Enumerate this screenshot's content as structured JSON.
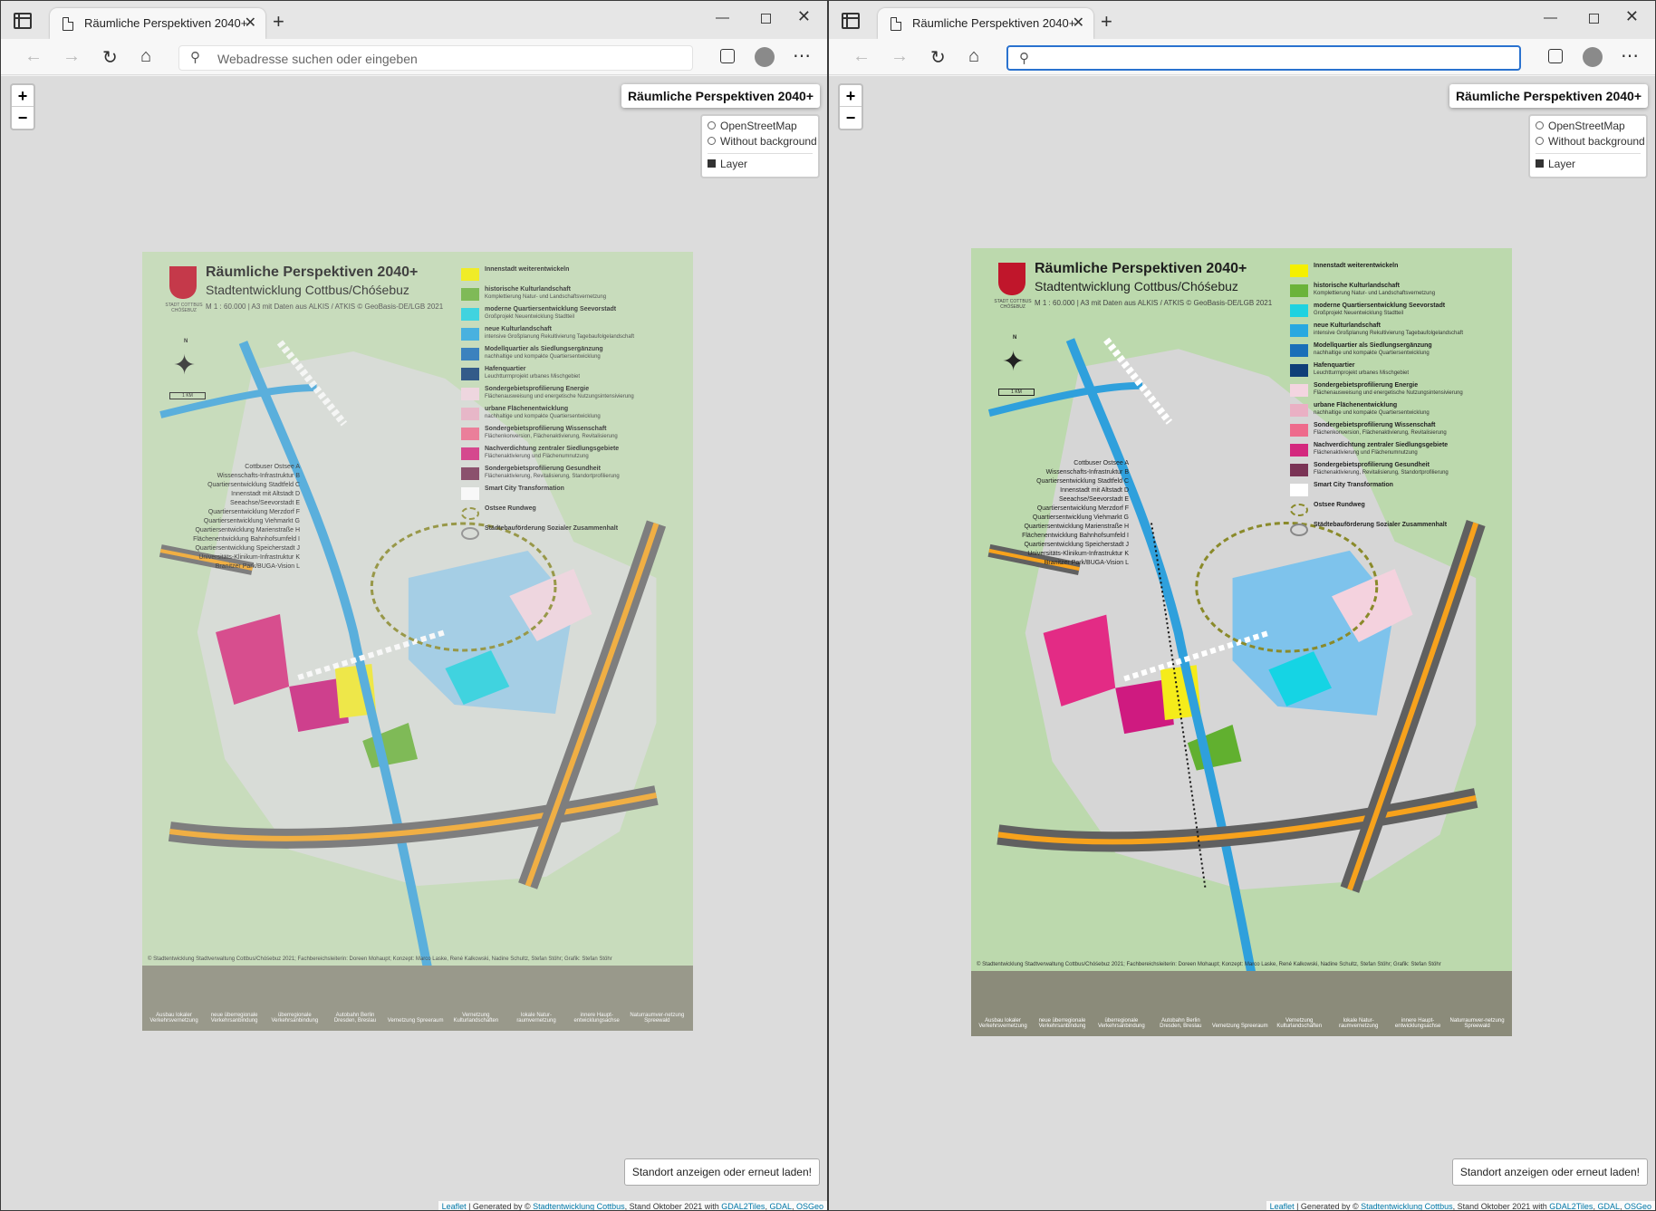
{
  "browser": {
    "tab_title": "Räumliche Perspektiven 2040+",
    "close_glyph": "✕",
    "new_tab_glyph": "+",
    "address_placeholder_left": "Webadresse suchen oder eingeben",
    "address_value_right": ""
  },
  "map": {
    "zoom_in": "+",
    "zoom_out": "−",
    "title": "Räumliche Perspektiven 2040+",
    "layers": {
      "osm": "OpenStreetMap",
      "without_bg": "Without background",
      "layer": "Layer"
    },
    "locate_button": "Standort anzeigen oder erneut laden!",
    "attribution": {
      "leaflet": "Leaflet",
      "generated_by": " | Generated by © ",
      "stadtentwicklung": "Stadtentwicklung Cottbus",
      "stand": ", Stand Oktober 2021 with ",
      "gdal2tiles": "GDAL2Tiles",
      "sep": ", ",
      "gdal": "GDAL",
      "osgeo": "OSGeo"
    }
  },
  "poster": {
    "title": "Räumliche Perspektiven 2040+",
    "subtitle": "Stadtentwicklung Cottbus/Chóśebuz",
    "scale": "M 1 : 60.000 | A3 mit Daten aus ALKIS / ATKIS © GeoBasis-DE/LGB 2021",
    "crest_caption": "STADT COTTBUS CHÓŚEBUZ",
    "compass_n": "N",
    "scalebar": "1 KM",
    "legend": [
      {
        "title": "Innenstadt weiterentwickeln",
        "sub": "",
        "color": "#f5f000"
      },
      {
        "title": "historische Kulturlandschaft",
        "sub": "Komplettierung Natur- und Landschaftsvernetzung",
        "color": "#6bb33a"
      },
      {
        "title": "moderne Quartiersentwicklung Seevorstadt",
        "sub": "Großprojekt Neuentwicklung Stadtteil",
        "color": "#1fd2e0"
      },
      {
        "title": "neue Kulturlandschaft",
        "sub": "intensive Großplanung Rekultivierung Tagebaufolgelandschaft",
        "color": "#29a8e0"
      },
      {
        "title": "Modellquartier als Siedlungsergänzung",
        "sub": "nachhaltige und kompakte Quartiersentwicklung",
        "color": "#1a6fb8"
      },
      {
        "title": "Hafenquartier",
        "sub": "Leuchtturmprojekt urbanes Mischgebiet",
        "color": "#0f3f78"
      },
      {
        "title": "Sondergebietsprofilierung Energie",
        "sub": "Flächenausweisung und energetische Nutzungsintensivierung",
        "color": "#f3d5e0"
      },
      {
        "title": "urbane Flächenentwicklung",
        "sub": "nachhaltige und kompakte Quartiersentwicklung",
        "color": "#eab0c4"
      },
      {
        "title": "Sondergebietsprofilierung Wissenschaft",
        "sub": "Flächenkonversion, Flächenaktivierung, Revitalisierung",
        "color": "#ee6b8c"
      },
      {
        "title": "Nachverdichtung zentraler Siedlungsgebiete",
        "sub": "Flächenaktivierung und Flächenumnutzung",
        "color": "#d4287e"
      },
      {
        "title": "Sondergebietsprofilierung Gesundheit",
        "sub": "Flächenaktivierung, Revitalisierung, Standortprofilierung",
        "color": "#7a3355"
      },
      {
        "title": "Smart City Transformation",
        "sub": "",
        "color": "#ffffff"
      },
      {
        "title": "Ostsee Rundweg",
        "sub": "",
        "color": "ring"
      },
      {
        "title": "Städtebauförderung Sozialer Zusammenhalt",
        "sub": "",
        "color": "ring2"
      }
    ],
    "projects": [
      "Cottbuser Ostsee  A",
      "Wissenschafts-Infrastruktur  B",
      "Quartiersentwicklung Stadtfeld  C",
      "Innenstadt mit Altstadt  D",
      "Seeachse/Seevorstadt  E",
      "Quartiersentwicklung Merzdorf  F",
      "Quartiersentwicklung Viehmarkt  G",
      "Quartiersentwicklung Marienstraße  H",
      "Flächenentwicklung Bahnhofsumfeld  I",
      "Quartiersentwicklung Speicherstadt  J",
      "Universitäts-Klinikum-Infrastruktur  K",
      "Branitzer Park/BUGA-Vision  L"
    ],
    "credits": "© Stadtentwicklung Stadtverwaltung Cottbus/Chóśebuz 2021; Fachbereichsleiterin: Doreen Mohaupt; Konzept: Marco Laske, René Kalkowski, Nadine Schultz, Stefan Stöhr; Grafik: Stefan Stöhr",
    "arrow_labels": [
      "Ausbau lokaler Verkehrsvernetzung",
      "neue überregionale Verkehrsanbindung",
      "überregionale Verkehrsanbindung",
      "Autobahn Berlin Dresden, Breslau",
      "Vernetzung Spreeraum",
      "Vernetzung Kulturlandschaften",
      "lokale Natur-raumvernetzung",
      "innere Haupt-entwicklungsachse",
      "Naturraumver-netzung Spreewald"
    ]
  }
}
